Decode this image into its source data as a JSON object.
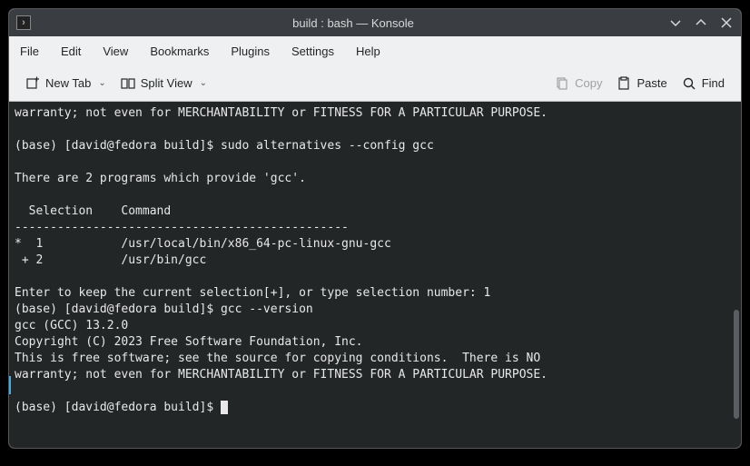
{
  "title": "build : bash — Konsole",
  "menubar": [
    "File",
    "Edit",
    "View",
    "Bookmarks",
    "Plugins",
    "Settings",
    "Help"
  ],
  "toolbar": {
    "new_tab": "New Tab",
    "split_view": "Split View",
    "copy": "Copy",
    "paste": "Paste",
    "find": "Find"
  },
  "terminal_lines": [
    "warranty; not even for MERCHANTABILITY or FITNESS FOR A PARTICULAR PURPOSE.",
    "",
    "(base) [david@fedora build]$ sudo alternatives --config gcc",
    "",
    "There are 2 programs which provide 'gcc'.",
    "",
    "  Selection    Command",
    "-----------------------------------------------",
    "*  1           /usr/local/bin/x86_64-pc-linux-gnu-gcc",
    " + 2           /usr/bin/gcc",
    "",
    "Enter to keep the current selection[+], or type selection number: 1",
    "(base) [david@fedora build]$ gcc --version",
    "gcc (GCC) 13.2.0",
    "Copyright (C) 2023 Free Software Foundation, Inc.",
    "This is free software; see the source for copying conditions.  There is NO",
    "warranty; not even for MERCHANTABILITY or FITNESS FOR A PARTICULAR PURPOSE.",
    "",
    "(base) [david@fedora build]$ "
  ]
}
